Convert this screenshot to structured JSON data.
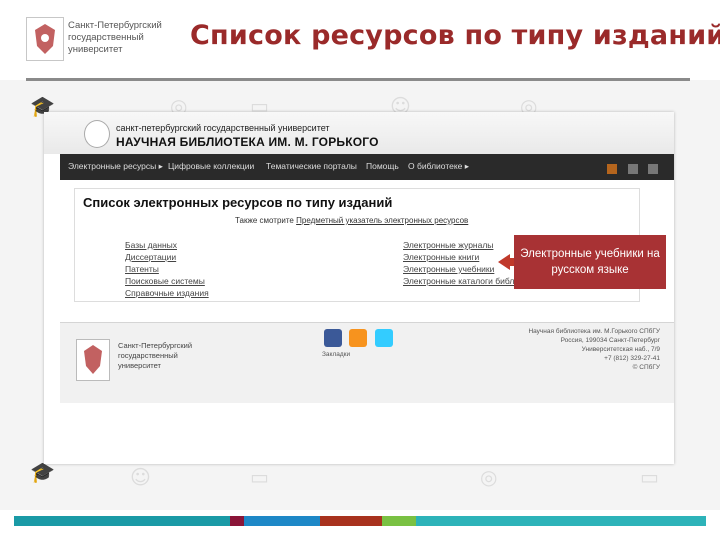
{
  "slide": {
    "title": "Список ресурсов по типу изданий",
    "logo_text": [
      "Санкт-Петербургский",
      "государственный",
      "университет"
    ]
  },
  "screenshot": {
    "library_name_small": "санкт-петербургский государственный университет",
    "library_name_big": "НАУЧНАЯ БИБЛИОТЕКА ИМ. М. ГОРЬКОГО",
    "nav": [
      "Электронные ресурсы ▸",
      "Цифровые коллекции",
      "Тематические порталы",
      "Помощь",
      "О библиотеке ▸"
    ],
    "page_title": "Список электронных ресурсов по типу изданий",
    "see_also_prefix": "Также смотрите",
    "see_also_link": "Предметный указатель электронных ресурсов",
    "left_links": [
      "Базы данных",
      "Диссертации",
      "Патенты",
      "Поисковые системы",
      "Справочные издания"
    ],
    "right_links": [
      "Электронные журналы",
      "Электронные книги",
      "Электронные учебники",
      "Электронные каталоги библиотек"
    ],
    "footer": {
      "univ_name": [
        "Санкт-Петербургский",
        "государственный",
        "университет"
      ],
      "share_text": "Закладки",
      "address": [
        "Научная библиотека им. М.Горького СПбГУ",
        "Россия, 199034 Санкт-Петербург",
        "Университетская наб., 7/9",
        "+7 (812) 329-27-41",
        "© СПбГУ"
      ]
    }
  },
  "callout": {
    "text": "Электронные учебники на русском языке",
    "color": "#a83234"
  },
  "colors": {
    "title": "#9a2a2a",
    "bottom_bar": [
      "#1a9aa6",
      "#2db3b9",
      "#8a1538",
      "#1e88c7",
      "#a8321e",
      "#7ac143",
      "#2db3b9"
    ]
  }
}
